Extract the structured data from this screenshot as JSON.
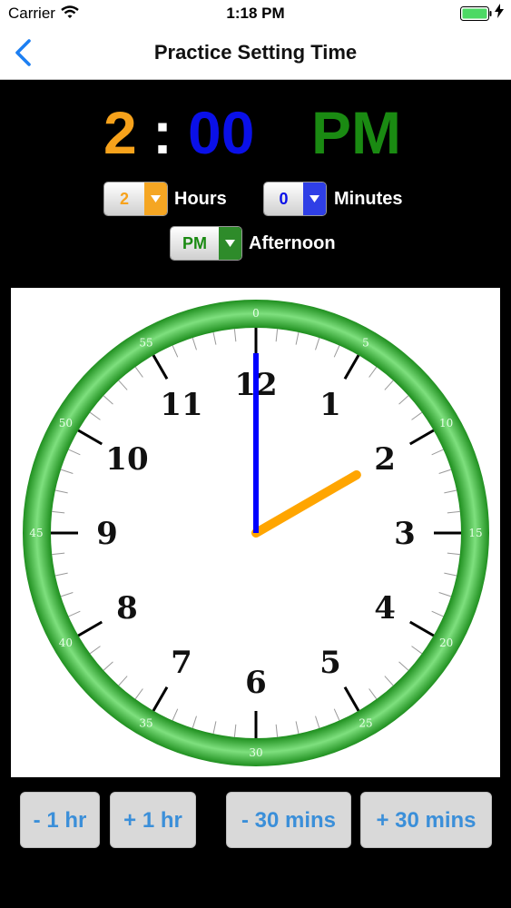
{
  "status_bar": {
    "carrier": "Carrier",
    "time": "1:18 PM"
  },
  "nav": {
    "title": "Practice Setting Time"
  },
  "display": {
    "hour": "2",
    "separator": ":",
    "minutes": "00",
    "period": "PM"
  },
  "selectors": {
    "hours": {
      "value": "2",
      "label": "Hours"
    },
    "minutes": {
      "value": "0",
      "label": "Minutes"
    },
    "period": {
      "value": "PM",
      "label": "Afternoon"
    }
  },
  "clock": {
    "hour_numbers": [
      "12",
      "1",
      "2",
      "3",
      "4",
      "5",
      "6",
      "7",
      "8",
      "9",
      "10",
      "11"
    ],
    "minute_labels": [
      "0",
      "5",
      "10",
      "15",
      "20",
      "25",
      "30",
      "35",
      "40",
      "45",
      "50",
      "55"
    ],
    "hour": 2,
    "minute": 0
  },
  "buttons": {
    "minus_hour": "- 1 hr",
    "plus_hour": "+ 1 hr",
    "minus_30": "- 30 mins",
    "plus_30": "+ 30 mins"
  },
  "colors": {
    "hour_digit": "#f7a21b",
    "minute_digit": "#0a10e8",
    "period": "#1a8a12",
    "hour_hand": "#ffa500",
    "minute_hand": "#0000ff",
    "rim": "#3cb83c",
    "button_text": "#3b8fd9"
  }
}
